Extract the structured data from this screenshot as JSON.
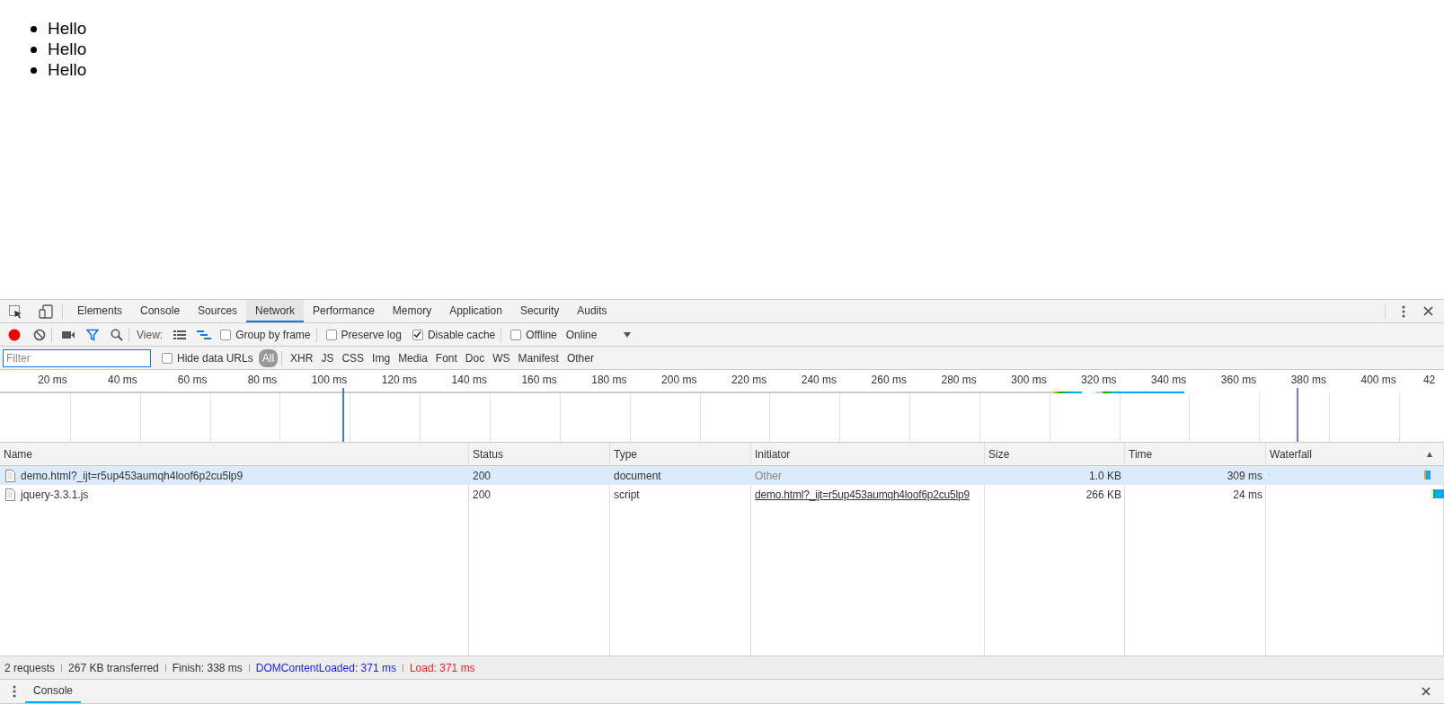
{
  "page": {
    "list_items": [
      "Hello",
      "Hello",
      "Hello"
    ]
  },
  "devtools": {
    "tabs": [
      {
        "label": "Elements",
        "selected": false
      },
      {
        "label": "Console",
        "selected": false
      },
      {
        "label": "Sources",
        "selected": false
      },
      {
        "label": "Network",
        "selected": true
      },
      {
        "label": "Performance",
        "selected": false
      },
      {
        "label": "Memory",
        "selected": false
      },
      {
        "label": "Application",
        "selected": false
      },
      {
        "label": "Security",
        "selected": false
      },
      {
        "label": "Audits",
        "selected": false
      }
    ],
    "toolbar": {
      "recording": true,
      "filter_on": true,
      "view_label": "View:",
      "large_rows": false,
      "overview_on": true,
      "checkboxes": [
        {
          "label": "Group by frame",
          "checked": false
        },
        {
          "label": "Preserve log",
          "checked": false
        },
        {
          "label": "Disable cache",
          "checked": true
        },
        {
          "label": "Offline",
          "checked": false
        }
      ],
      "throttling": "Online"
    },
    "filter_bar": {
      "placeholder": "Filter",
      "hide_data_urls": {
        "label": "Hide data URLs",
        "checked": false
      },
      "types": [
        {
          "label": "All",
          "selected": true
        },
        {
          "label": "XHR",
          "selected": false
        },
        {
          "label": "JS",
          "selected": false
        },
        {
          "label": "CSS",
          "selected": false
        },
        {
          "label": "Img",
          "selected": false
        },
        {
          "label": "Media",
          "selected": false
        },
        {
          "label": "Font",
          "selected": false
        },
        {
          "label": "Doc",
          "selected": false
        },
        {
          "label": "WS",
          "selected": false
        },
        {
          "label": "Manifest",
          "selected": false
        },
        {
          "label": "Other",
          "selected": false
        }
      ]
    },
    "overview": {
      "ticks": [
        "20 ms",
        "40 ms",
        "60 ms",
        "80 ms",
        "100 ms",
        "120 ms",
        "140 ms",
        "160 ms",
        "180 ms",
        "200 ms",
        "220 ms",
        "240 ms",
        "260 ms",
        "280 ms",
        "300 ms",
        "320 ms",
        "340 ms",
        "360 ms",
        "380 ms",
        "400 ms",
        "42"
      ]
    },
    "table": {
      "columns": [
        "Name",
        "Status",
        "Type",
        "Initiator",
        "Size",
        "Time",
        "Waterfall"
      ],
      "sort_icon": "▲",
      "rows": [
        {
          "name": "demo.html?_ijt=r5up453aumqh4loof6p2cu5lp9",
          "status": "200",
          "type": "document",
          "initiator": {
            "text": "Other",
            "kind": "other"
          },
          "size": "1.0 KB",
          "time": "309 ms",
          "selected": true
        },
        {
          "name": "jquery-3.3.1.js",
          "status": "200",
          "type": "script",
          "initiator": {
            "text": "demo.html?_ijt=r5up453aumqh4loof6p2cu5lp9",
            "kind": "link"
          },
          "size": "266 KB",
          "time": "24 ms",
          "selected": false
        }
      ]
    },
    "status_bar": [
      {
        "text": "2 requests",
        "color": "#333333"
      },
      {
        "text": "267 KB transferred",
        "color": "#333333"
      },
      {
        "text": "Finish: 338 ms",
        "color": "#333333"
      },
      {
        "text": "DOMContentLoaded: 371 ms",
        "color": "#1a1aff"
      },
      {
        "text": "Load: 371 ms",
        "color": "#ff1a1a"
      }
    ],
    "drawer": {
      "tabs": [
        {
          "label": "Console",
          "selected": true
        }
      ]
    }
  }
}
